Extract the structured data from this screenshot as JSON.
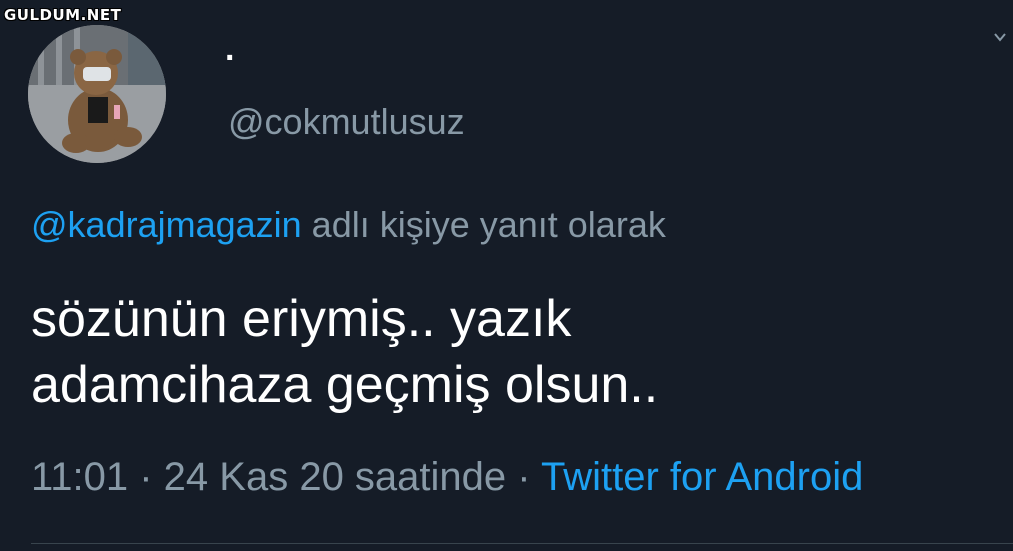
{
  "watermark": "GULDUM.NET",
  "user": {
    "display_name": ".",
    "handle": "@cokmutlusuz"
  },
  "reply": {
    "to_user": "@kadrajmagazin",
    "suffix": " adlı kişiye yanıt olarak"
  },
  "tweet": {
    "line1": "sözünün eriymiş.. yazık",
    "line2": "adamcihaza geçmiş olsun.."
  },
  "meta": {
    "time_date": "11:01 · 24 Kas 20 saatinde · ",
    "source": "Twitter for Android"
  },
  "colors": {
    "background": "#151c27",
    "link": "#1da1f2",
    "secondary_text": "#8899a6"
  }
}
